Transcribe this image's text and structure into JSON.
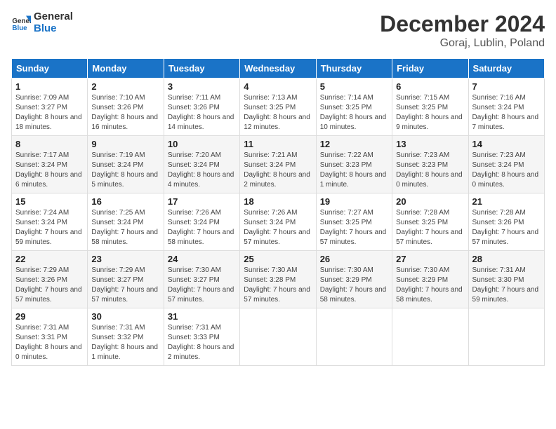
{
  "header": {
    "logo_line1": "General",
    "logo_line2": "Blue",
    "month": "December 2024",
    "location": "Goraj, Lublin, Poland"
  },
  "weekdays": [
    "Sunday",
    "Monday",
    "Tuesday",
    "Wednesday",
    "Thursday",
    "Friday",
    "Saturday"
  ],
  "weeks": [
    [
      {
        "day": "1",
        "sunrise": "Sunrise: 7:09 AM",
        "sunset": "Sunset: 3:27 PM",
        "daylight": "Daylight: 8 hours and 18 minutes."
      },
      {
        "day": "2",
        "sunrise": "Sunrise: 7:10 AM",
        "sunset": "Sunset: 3:26 PM",
        "daylight": "Daylight: 8 hours and 16 minutes."
      },
      {
        "day": "3",
        "sunrise": "Sunrise: 7:11 AM",
        "sunset": "Sunset: 3:26 PM",
        "daylight": "Daylight: 8 hours and 14 minutes."
      },
      {
        "day": "4",
        "sunrise": "Sunrise: 7:13 AM",
        "sunset": "Sunset: 3:25 PM",
        "daylight": "Daylight: 8 hours and 12 minutes."
      },
      {
        "day": "5",
        "sunrise": "Sunrise: 7:14 AM",
        "sunset": "Sunset: 3:25 PM",
        "daylight": "Daylight: 8 hours and 10 minutes."
      },
      {
        "day": "6",
        "sunrise": "Sunrise: 7:15 AM",
        "sunset": "Sunset: 3:25 PM",
        "daylight": "Daylight: 8 hours and 9 minutes."
      },
      {
        "day": "7",
        "sunrise": "Sunrise: 7:16 AM",
        "sunset": "Sunset: 3:24 PM",
        "daylight": "Daylight: 8 hours and 7 minutes."
      }
    ],
    [
      {
        "day": "8",
        "sunrise": "Sunrise: 7:17 AM",
        "sunset": "Sunset: 3:24 PM",
        "daylight": "Daylight: 8 hours and 6 minutes."
      },
      {
        "day": "9",
        "sunrise": "Sunrise: 7:19 AM",
        "sunset": "Sunset: 3:24 PM",
        "daylight": "Daylight: 8 hours and 5 minutes."
      },
      {
        "day": "10",
        "sunrise": "Sunrise: 7:20 AM",
        "sunset": "Sunset: 3:24 PM",
        "daylight": "Daylight: 8 hours and 4 minutes."
      },
      {
        "day": "11",
        "sunrise": "Sunrise: 7:21 AM",
        "sunset": "Sunset: 3:24 PM",
        "daylight": "Daylight: 8 hours and 2 minutes."
      },
      {
        "day": "12",
        "sunrise": "Sunrise: 7:22 AM",
        "sunset": "Sunset: 3:23 PM",
        "daylight": "Daylight: 8 hours and 1 minute."
      },
      {
        "day": "13",
        "sunrise": "Sunrise: 7:23 AM",
        "sunset": "Sunset: 3:23 PM",
        "daylight": "Daylight: 8 hours and 0 minutes."
      },
      {
        "day": "14",
        "sunrise": "Sunrise: 7:23 AM",
        "sunset": "Sunset: 3:24 PM",
        "daylight": "Daylight: 8 hours and 0 minutes."
      }
    ],
    [
      {
        "day": "15",
        "sunrise": "Sunrise: 7:24 AM",
        "sunset": "Sunset: 3:24 PM",
        "daylight": "Daylight: 7 hours and 59 minutes."
      },
      {
        "day": "16",
        "sunrise": "Sunrise: 7:25 AM",
        "sunset": "Sunset: 3:24 PM",
        "daylight": "Daylight: 7 hours and 58 minutes."
      },
      {
        "day": "17",
        "sunrise": "Sunrise: 7:26 AM",
        "sunset": "Sunset: 3:24 PM",
        "daylight": "Daylight: 7 hours and 58 minutes."
      },
      {
        "day": "18",
        "sunrise": "Sunrise: 7:26 AM",
        "sunset": "Sunset: 3:24 PM",
        "daylight": "Daylight: 7 hours and 57 minutes."
      },
      {
        "day": "19",
        "sunrise": "Sunrise: 7:27 AM",
        "sunset": "Sunset: 3:25 PM",
        "daylight": "Daylight: 7 hours and 57 minutes."
      },
      {
        "day": "20",
        "sunrise": "Sunrise: 7:28 AM",
        "sunset": "Sunset: 3:25 PM",
        "daylight": "Daylight: 7 hours and 57 minutes."
      },
      {
        "day": "21",
        "sunrise": "Sunrise: 7:28 AM",
        "sunset": "Sunset: 3:26 PM",
        "daylight": "Daylight: 7 hours and 57 minutes."
      }
    ],
    [
      {
        "day": "22",
        "sunrise": "Sunrise: 7:29 AM",
        "sunset": "Sunset: 3:26 PM",
        "daylight": "Daylight: 7 hours and 57 minutes."
      },
      {
        "day": "23",
        "sunrise": "Sunrise: 7:29 AM",
        "sunset": "Sunset: 3:27 PM",
        "daylight": "Daylight: 7 hours and 57 minutes."
      },
      {
        "day": "24",
        "sunrise": "Sunrise: 7:30 AM",
        "sunset": "Sunset: 3:27 PM",
        "daylight": "Daylight: 7 hours and 57 minutes."
      },
      {
        "day": "25",
        "sunrise": "Sunrise: 7:30 AM",
        "sunset": "Sunset: 3:28 PM",
        "daylight": "Daylight: 7 hours and 57 minutes."
      },
      {
        "day": "26",
        "sunrise": "Sunrise: 7:30 AM",
        "sunset": "Sunset: 3:29 PM",
        "daylight": "Daylight: 7 hours and 58 minutes."
      },
      {
        "day": "27",
        "sunrise": "Sunrise: 7:30 AM",
        "sunset": "Sunset: 3:29 PM",
        "daylight": "Daylight: 7 hours and 58 minutes."
      },
      {
        "day": "28",
        "sunrise": "Sunrise: 7:31 AM",
        "sunset": "Sunset: 3:30 PM",
        "daylight": "Daylight: 7 hours and 59 minutes."
      }
    ],
    [
      {
        "day": "29",
        "sunrise": "Sunrise: 7:31 AM",
        "sunset": "Sunset: 3:31 PM",
        "daylight": "Daylight: 8 hours and 0 minutes."
      },
      {
        "day": "30",
        "sunrise": "Sunrise: 7:31 AM",
        "sunset": "Sunset: 3:32 PM",
        "daylight": "Daylight: 8 hours and 1 minute."
      },
      {
        "day": "31",
        "sunrise": "Sunrise: 7:31 AM",
        "sunset": "Sunset: 3:33 PM",
        "daylight": "Daylight: 8 hours and 2 minutes."
      },
      null,
      null,
      null,
      null
    ]
  ]
}
